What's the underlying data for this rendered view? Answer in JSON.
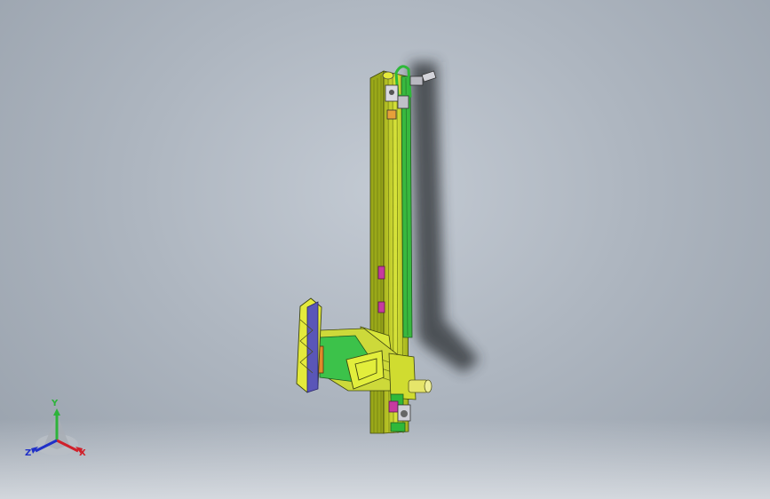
{
  "viewport": {
    "background_top": "#c3cad3",
    "background_bottom": "#97a0ab"
  },
  "triad": {
    "x_label": "X",
    "y_label": "Y",
    "z_label": "Z",
    "x_color": "#d0202a",
    "y_color": "#2db33a",
    "z_color": "#2030c8"
  },
  "model": {
    "body_color": "#c6d62a",
    "accent_green": "#39c043",
    "accent_pink": "#c63aa0",
    "accent_blue": "#5a56b8",
    "accent_orange": "#e08a2a"
  }
}
